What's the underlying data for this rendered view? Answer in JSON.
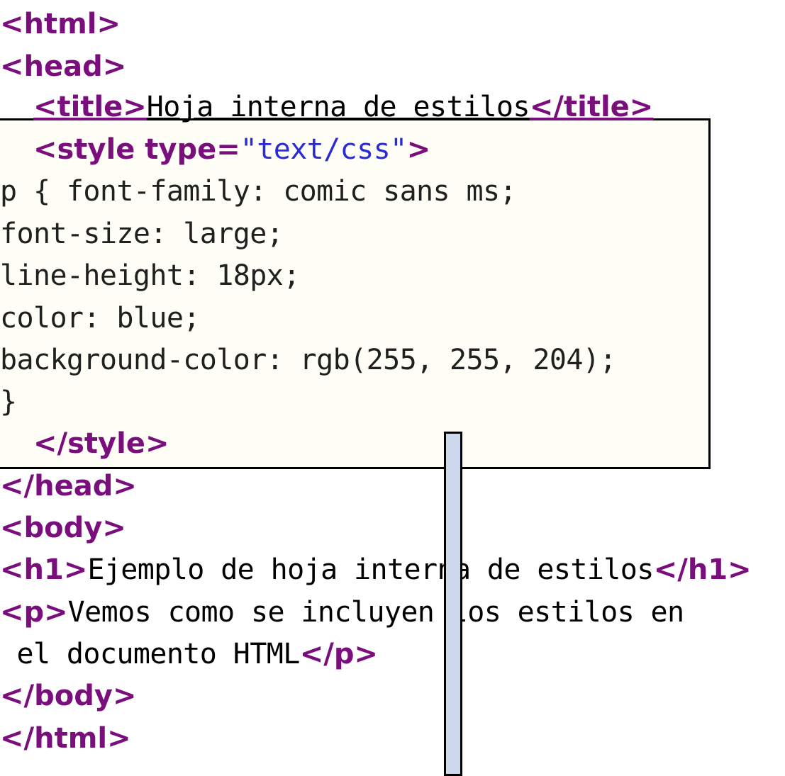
{
  "editor": {
    "lines": [
      {
        "parts": [
          {
            "t": "<html>",
            "k": "tag"
          }
        ]
      },
      {
        "parts": [
          {
            "t": "<head>",
            "k": "tag"
          }
        ]
      },
      {
        "parts": [
          {
            "t": "  ",
            "k": "plain"
          },
          {
            "t": "<title>",
            "k": "tag"
          },
          {
            "t": "Hoja interna de estilos",
            "k": "plain"
          },
          {
            "t": "</title>",
            "k": "tag"
          }
        ]
      },
      {
        "parts": [
          {
            "t": "  ",
            "k": "plain"
          },
          {
            "t": "<style ",
            "k": "tag"
          },
          {
            "t": "type=",
            "k": "tag"
          },
          {
            "t": "\"text/css\"",
            "k": "str"
          },
          {
            "t": ">",
            "k": "tag"
          }
        ]
      },
      {
        "parts": [
          {
            "t": "p { font-family: comic sans ms;",
            "k": "css"
          }
        ]
      },
      {
        "parts": [
          {
            "t": "font-size: large;",
            "k": "css"
          }
        ]
      },
      {
        "parts": [
          {
            "t": "line-height: 18px;",
            "k": "css"
          }
        ]
      },
      {
        "parts": [
          {
            "t": "color: blue;",
            "k": "css"
          }
        ]
      },
      {
        "parts": [
          {
            "t": "background-color: rgb(255, 255, 204);",
            "k": "css"
          }
        ]
      },
      {
        "parts": [
          {
            "t": "}",
            "k": "css"
          }
        ]
      },
      {
        "parts": [
          {
            "t": "  ",
            "k": "plain"
          },
          {
            "t": "</style>",
            "k": "tag"
          }
        ]
      },
      {
        "parts": [
          {
            "t": "</head>",
            "k": "tag"
          }
        ]
      },
      {
        "parts": [
          {
            "t": "<body>",
            "k": "tag"
          }
        ]
      },
      {
        "parts": [
          {
            "t": "<h1>",
            "k": "tag"
          },
          {
            "t": "Ejemplo de hoja interna de estilos",
            "k": "plain"
          },
          {
            "t": "</h1>",
            "k": "tag"
          }
        ]
      },
      {
        "parts": [
          {
            "t": "<p>",
            "k": "tag"
          },
          {
            "t": "Vemos como se incluyen los estilos en",
            "k": "plain"
          }
        ]
      },
      {
        "parts": [
          {
            "t": " el documento HTML",
            "k": "plain"
          },
          {
            "t": "</p>",
            "k": "tag"
          }
        ]
      },
      {
        "parts": [
          {
            "t": "</body>",
            "k": "tag"
          }
        ]
      },
      {
        "parts": [
          {
            "t": "</html>",
            "k": "tag"
          }
        ]
      }
    ]
  },
  "colors": {
    "tag": "#7a0e7d",
    "string": "#2b2bd6",
    "text": "#000000",
    "highlight_background": "#fefef6",
    "bar_fill": "#cdd8ee"
  }
}
